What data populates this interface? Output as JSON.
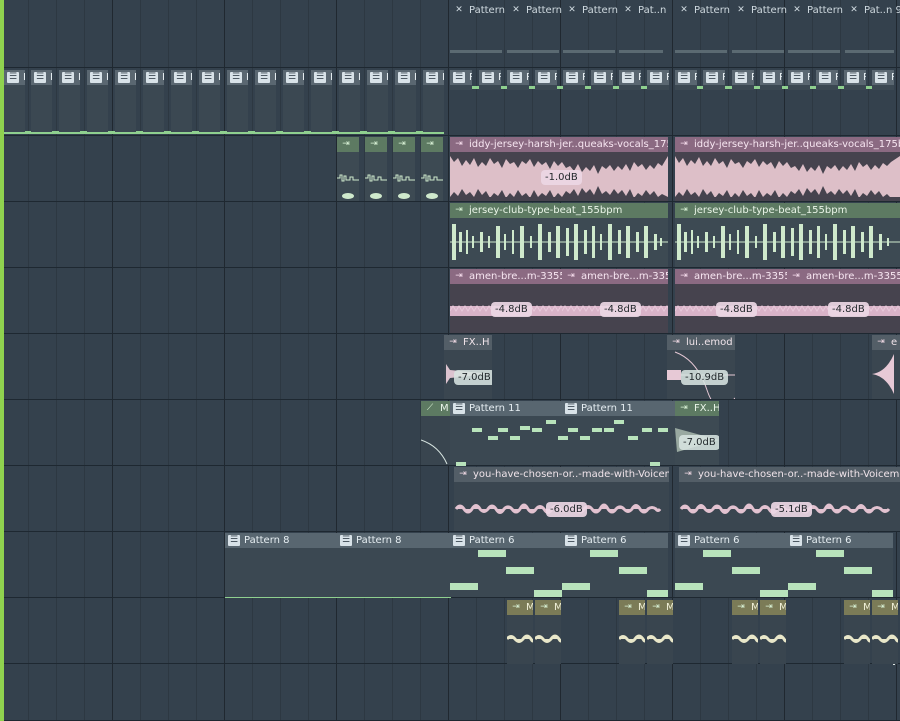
{
  "colors": {
    "playhead": "#8fd24f",
    "pattern_note": "#b8e3bb",
    "green_wave": "#cfe9cc",
    "pink_wave": "#d9b3c8"
  },
  "clips": {
    "pattern9": "Pattern 9",
    "pattern9_trunc": "Pat..n 9",
    "p": "P",
    "iddy": "iddy-jersey-harsh-jer..queaks-vocals_175bpm",
    "iddy_db": "-1.0dB",
    "jersey": "jersey-club-type-beat_155bpm",
    "amen": "amen-bre...m-335522",
    "amen_db": "-4.8dB",
    "fx_h": "FX..H",
    "fx_db": "-7.0dB",
    "lui": "lui..emod",
    "lui_db": "-10.9dB",
    "e": "e",
    "pattern11": "Pattern 11",
    "m": "M",
    "you": "you-have-chosen-or..-made-with-Voicemod",
    "you_db1": "-6.0dB",
    "you_db2": "-5.1dB",
    "pattern8": "Pattern 8",
    "pattern6": "Pattern 6"
  },
  "icons": {
    "pattern": "pattern-icon",
    "audio": "audio-clip-icon",
    "automation": "automation-icon"
  }
}
